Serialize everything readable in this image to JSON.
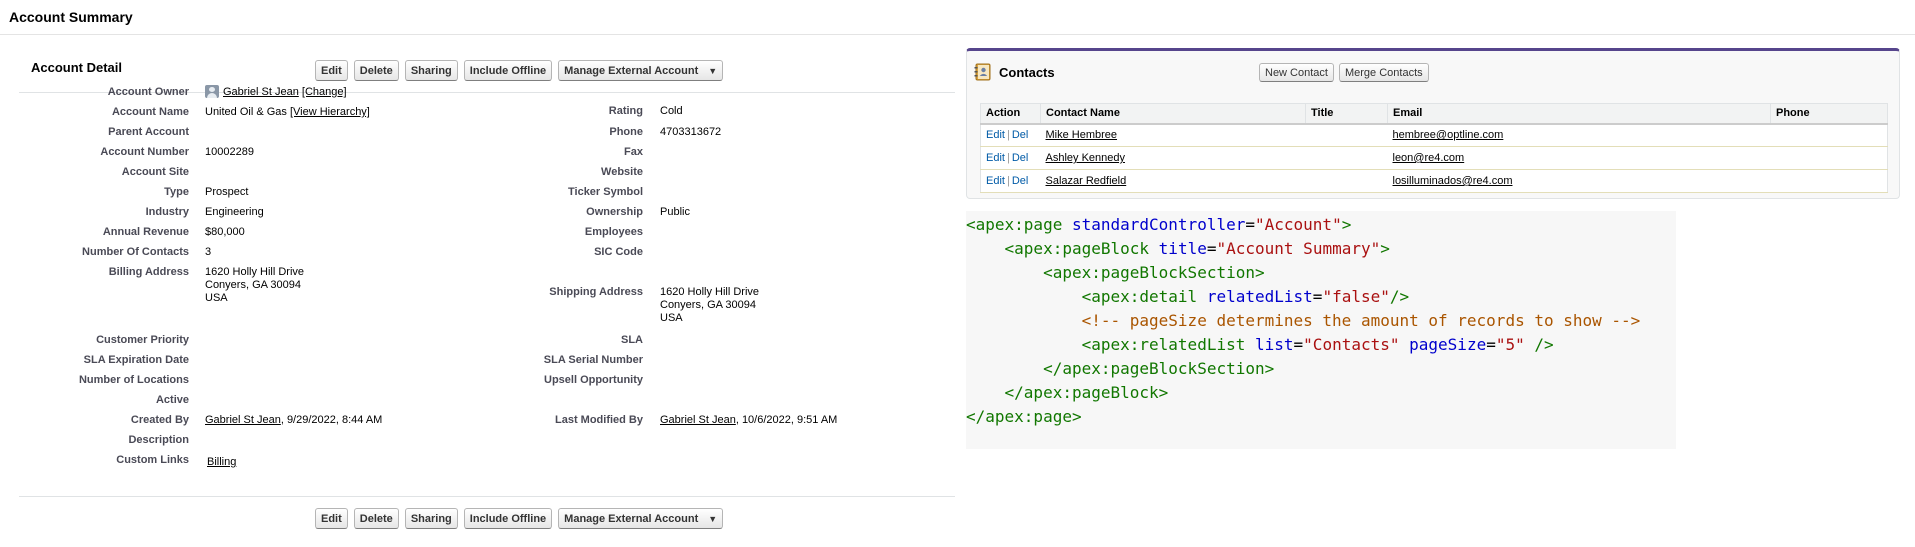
{
  "page": {
    "title": "Account Summary"
  },
  "detail": {
    "title": "Account Detail",
    "buttons": [
      "Edit",
      "Delete",
      "Sharing",
      "Include Offline",
      "Manage External Account"
    ],
    "fields": {
      "account_owner": {
        "label": "Account Owner",
        "value": "Gabriel St Jean",
        "action": "[Change]"
      },
      "account_name": {
        "label": "Account Name",
        "value": "United Oil & Gas",
        "action": "[View Hierarchy]"
      },
      "parent_account": {
        "label": "Parent Account",
        "value": ""
      },
      "account_number": {
        "label": "Account Number",
        "value": "10002289"
      },
      "account_site": {
        "label": "Account Site",
        "value": ""
      },
      "type": {
        "label": "Type",
        "value": "Prospect"
      },
      "industry": {
        "label": "Industry",
        "value": "Engineering"
      },
      "annual_revenue": {
        "label": "Annual Revenue",
        "value": "$80,000"
      },
      "number_of_contacts": {
        "label": "Number Of Contacts",
        "value": "3"
      },
      "billing_address": {
        "label": "Billing Address",
        "lines": [
          "1620 Holly Hill Drive",
          "Conyers, GA 30094",
          "USA"
        ]
      },
      "customer_priority": {
        "label": "Customer Priority",
        "value": ""
      },
      "sla_expiration_date": {
        "label": "SLA Expiration Date",
        "value": ""
      },
      "number_of_locations": {
        "label": "Number of Locations",
        "value": ""
      },
      "active": {
        "label": "Active",
        "value": ""
      },
      "created_by": {
        "label": "Created By",
        "user": "Gabriel St Jean",
        "date": ", 9/29/2022, 8:44 AM"
      },
      "description": {
        "label": "Description",
        "value": ""
      },
      "custom_links": {
        "label": "Custom Links",
        "value": "Billing"
      },
      "rating": {
        "label": "Rating",
        "value": "Cold"
      },
      "phone": {
        "label": "Phone",
        "value": "4703313672"
      },
      "fax": {
        "label": "Fax",
        "value": ""
      },
      "website": {
        "label": "Website",
        "value": ""
      },
      "ticker_symbol": {
        "label": "Ticker Symbol",
        "value": ""
      },
      "ownership": {
        "label": "Ownership",
        "value": "Public"
      },
      "employees": {
        "label": "Employees",
        "value": ""
      },
      "sic_code": {
        "label": "SIC Code",
        "value": ""
      },
      "shipping_address": {
        "label": "Shipping Address",
        "lines": [
          "1620 Holly Hill Drive",
          "Conyers, GA 30094",
          "USA"
        ]
      },
      "sla": {
        "label": "SLA",
        "value": ""
      },
      "sla_serial_number": {
        "label": "SLA Serial Number",
        "value": ""
      },
      "upsell_opportunity": {
        "label": "Upsell Opportunity",
        "value": ""
      },
      "last_modified_by": {
        "label": "Last Modified By",
        "user": "Gabriel St Jean",
        "date": ", 10/6/2022, 9:51 AM"
      }
    }
  },
  "contacts": {
    "title": "Contacts",
    "icon": "contacts-book-icon",
    "buttons": [
      "New Contact",
      "Merge Contacts"
    ],
    "columns": [
      "Action",
      "Contact Name",
      "Title",
      "Email",
      "Phone"
    ],
    "action_edit": "Edit",
    "action_sep": "|",
    "action_del": "Del",
    "rows": [
      {
        "name": "Mike Hembree",
        "title": "",
        "email": "hembree@optline.com",
        "phone": ""
      },
      {
        "name": "Ashley Kennedy",
        "title": "",
        "email": "leon@re4.com",
        "phone": ""
      },
      {
        "name": "Salazar Redfield",
        "title": "",
        "email": "losilluminados@re4.com",
        "phone": ""
      }
    ]
  },
  "code": {
    "lines": [
      "<apex:page standardController=\"Account\">",
      "    <apex:pageBlock title=\"Account Summary\">",
      "        <apex:pageBlockSection>",
      "            <apex:detail relatedList=\"false\"/>",
      "            <!-- pageSize determines the amount of records to show -->",
      "            <apex:relatedList list=\"Contacts\" pageSize=\"5\" />",
      "        </apex:pageBlockSection>",
      "    </apex:pageBlock>",
      "</apex:page>"
    ]
  },
  "colors": {
    "accent": "#56458c",
    "link": "#015ba7",
    "label": "#4a4a56"
  }
}
